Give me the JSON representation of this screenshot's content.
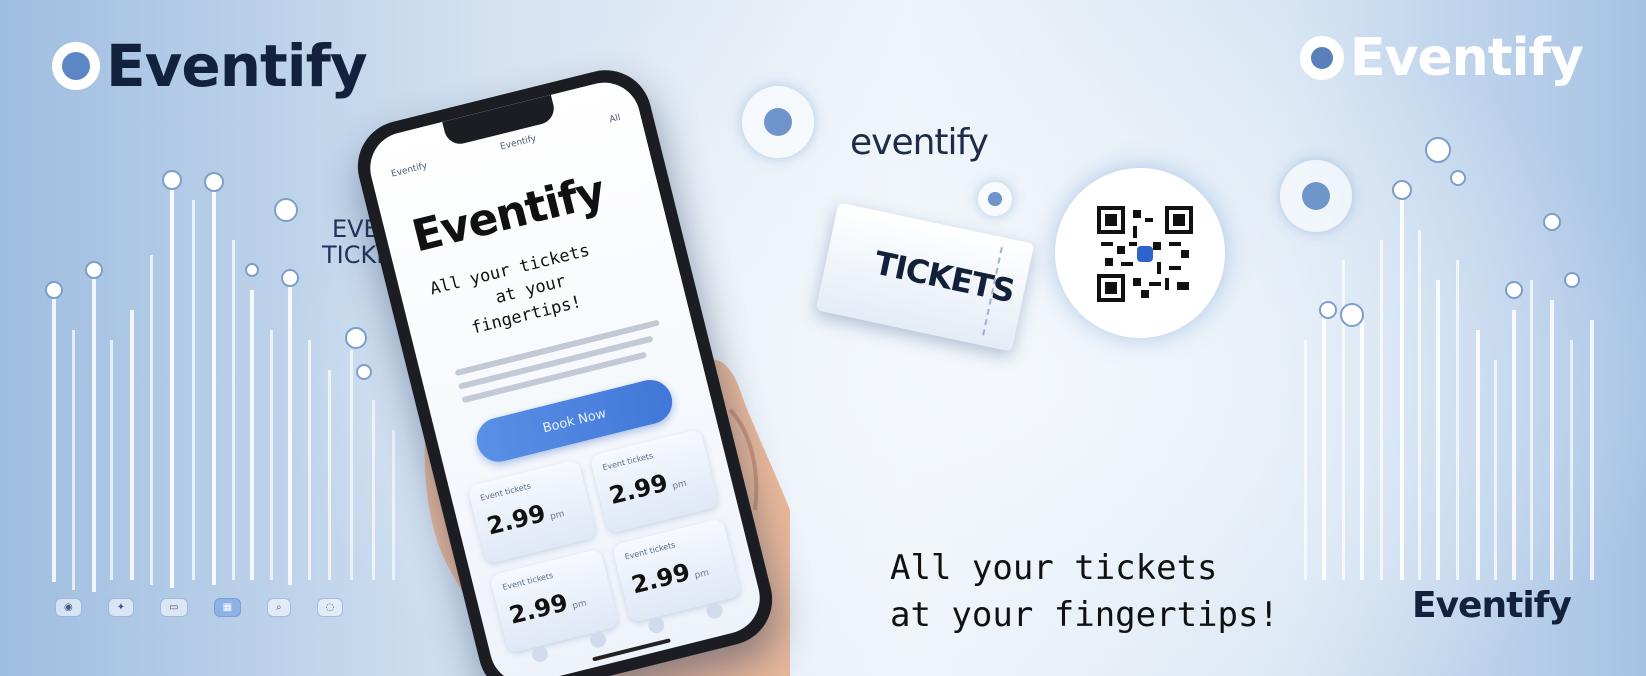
{
  "banner": {
    "brand_top_left": "Eventify",
    "brand_top_right": "Eventify",
    "brand_center": "eventify",
    "brand_bottom_right": "Eventify",
    "side_label": "EVENT\nTICKETS",
    "tagline": "All your tickets\nat your fingertips!",
    "ticket_label": "TICKETS",
    "colors": {
      "accent": "#4077d9",
      "text": "#13223c",
      "background": "#d4e2f1"
    }
  },
  "phone": {
    "status_left": "Eventify",
    "status_center": "Eventify",
    "status_right": "All",
    "app_title": "Eventify",
    "app_tagline": "All your tickets\n   at your\n fingertips!",
    "cta_label": "Book Now",
    "cards": [
      {
        "label": "Event tickets",
        "price": "2.99",
        "unit": "pm"
      },
      {
        "label": "Event tickets",
        "price": "2.99",
        "unit": "pm"
      },
      {
        "label": "Event tickets",
        "price": "2.99",
        "unit": "pm"
      },
      {
        "label": "Event tickets",
        "price": "2.99",
        "unit": "pm"
      }
    ]
  },
  "bottom_nav": {
    "items": [
      "home-icon",
      "wand-icon",
      "ticket-icon",
      "grid-icon",
      "search-icon",
      "chat-icon"
    ]
  }
}
